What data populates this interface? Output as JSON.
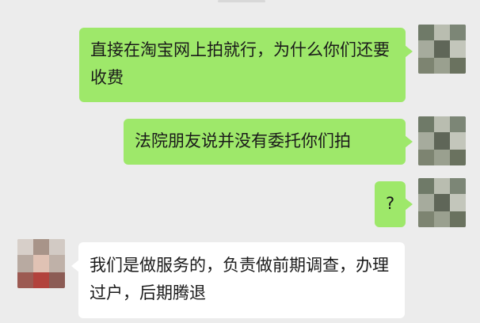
{
  "chat": {
    "messages": [
      {
        "sender": "me",
        "text": "直接在淘宝网上拍就行，为什么你们还要收费"
      },
      {
        "sender": "me",
        "text": "法院朋友说并没有委托你们拍"
      },
      {
        "sender": "me",
        "text": "?"
      },
      {
        "sender": "other",
        "text": "我们是做服务的，负责做前期调查，办理过户，后期腾退"
      }
    ]
  },
  "colors": {
    "background": "#ececec",
    "outgoing_bubble": "#9ee86a",
    "incoming_bubble": "#ffffff",
    "text": "#1a1a1a"
  },
  "icons": {
    "self_avatar": "blurred-avatar-icon",
    "contact_avatar": "blurred-avatar-icon"
  }
}
